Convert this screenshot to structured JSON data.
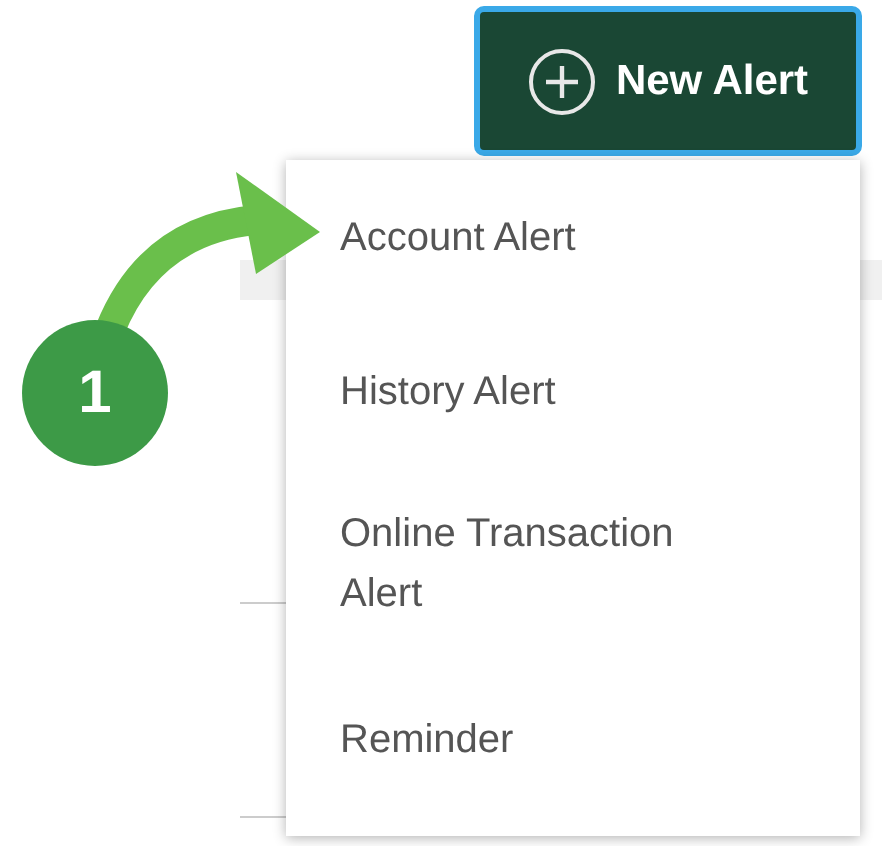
{
  "new_alert_button": {
    "label": "New Alert"
  },
  "menu": {
    "items": [
      {
        "label": "Account Alert"
      },
      {
        "label": "History Alert"
      },
      {
        "label": "Online Transaction Alert"
      },
      {
        "label": "Reminder"
      }
    ]
  },
  "callout": {
    "number": "1"
  }
}
